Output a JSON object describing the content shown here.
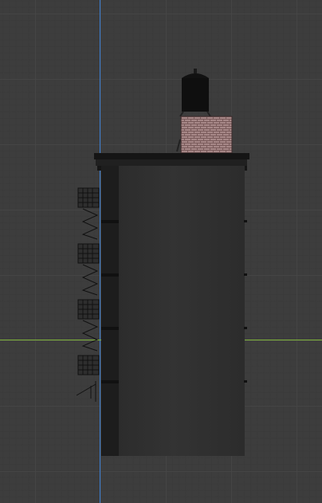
{
  "viewport": {
    "view": "orthographic-side",
    "grid": true,
    "colors": {
      "background": "#3d3d3d",
      "grid_line": "#464646",
      "z_axis": "#3b7fd4",
      "y_axis": "#7fb43a"
    }
  },
  "model": {
    "object": "building",
    "parts": [
      "water-tower",
      "roof-tank-crate",
      "cornice",
      "facade",
      "fire-escape"
    ],
    "colors": {
      "facade": "#2e2e2e",
      "facade_shadow": "#1d1d1d",
      "cornice": "#151515",
      "water_tower": "#0f0f0f",
      "crate": "#7a5b5b",
      "fire_escape": "#1a1a1a"
    }
  }
}
